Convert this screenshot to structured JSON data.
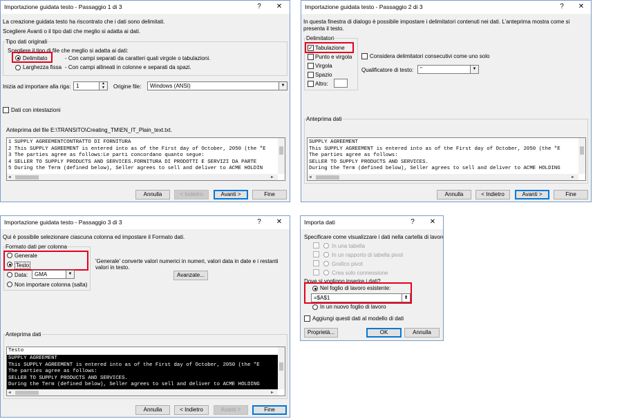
{
  "d1": {
    "title": "Importazione guidata testo - Passaggio 1 di 3",
    "help": "?",
    "close": "✕",
    "intro1": "La creazione guidata testo ha riscontrato che i dati sono delimitati.",
    "intro2": "Scegliere Avanti o il tipo dati che meglio si adatta ai dati.",
    "group_title": "Tipo dati originali",
    "choose_label": "Scegliere il tipo di file che meglio si adatta ai dati:",
    "opt_delim": "Delimitato",
    "opt_delim_desc": "- Con campi separati da caratteri quali virgole o tabulazioni.",
    "opt_fixed": "Larghezza fissa",
    "opt_fixed_desc": "- Con campi allineati in colonne e separati da spazi.",
    "start_row_label": "Inizia ad importare alla riga:",
    "start_row_value": "1",
    "origin_label": "Origine file:",
    "origin_value": "Windows (ANSI)",
    "headers_label": "Dati con intestazioni",
    "preview_label": "Anteprima del file E:\\TRANSITO\\Creating_TM\\EN_IT_Plain_text.txt.",
    "preview_lines": [
      "1 SUPPLY AGREEMENTCONTRATTO DI FORNITURA",
      "2 This SUPPLY AGREEMENT is entered into as of the First day of October, 2050 (the \"E",
      "3 The parties agree as follows:Le parti concordano quanto segue:",
      "4 SELLER TO SUPPLY PRODUCTS AND SERVICES.FORNITURA DI PRODOTTI E SERVIZI DA PARTE",
      "5 During the Term (defined below), Seller agrees to sell and deliver to ACME HOLDIN"
    ],
    "btn_cancel": "Annulla",
    "btn_back": "< Indietro",
    "btn_next": "Avanti >",
    "btn_finish": "Fine"
  },
  "d2": {
    "title": "Importazione guidata testo - Passaggio 2 di 3",
    "help": "?",
    "close": "✕",
    "intro1": "In questa finestra di dialogo è possibile impostare i delimitatori contenuti nei dati. L'anteprima mostra come si",
    "intro2": "presenta il testo.",
    "delim_title": "Delimitatori",
    "chk_tab": "Tabulazione",
    "chk_semicolon": "Punto e virgola",
    "chk_comma": "Virgola",
    "chk_space": "Spazio",
    "chk_other": "Altro:",
    "chk_tab_mark": "✓",
    "consecutive_label": "Considera delimitatori consecutivi come uno solo",
    "qualifier_label": "Qualificatore di testo:",
    "qualifier_value": "\"",
    "preview_label": "Anteprima dati",
    "preview_lines": [
      "SUPPLY AGREEMENT",
      "This SUPPLY AGREEMENT is entered into as of the First day of October, 2050 (the \"E",
      "The parties agree as follows:",
      "SELLER TO SUPPLY PRODUCTS AND SERVICES.",
      "During the Term (defined below), Seller agrees to sell and deliver to ACME HOLDING"
    ],
    "btn_cancel": "Annulla",
    "btn_back": "< Indietro",
    "btn_next": "Avanti >",
    "btn_finish": "Fine"
  },
  "d3": {
    "title": "Importazione guidata testo - Passaggio 3 di 3",
    "help": "?",
    "close": "✕",
    "intro1": "Qui è possibile selezionare ciascuna colonna ed impostare il Formato dati.",
    "group_title": "Formato dati per colonna",
    "opt_general": "Generale",
    "opt_text": "Testo",
    "opt_date": "Data:",
    "date_value": "GMA",
    "opt_skip": "Non importare colonna (salta)",
    "general_note1": "'Generale' converte valori numerici in numeri, valori data in date e i restanti",
    "general_note2": "valori in testo.",
    "btn_advanced": "Avanzate...",
    "preview_label": "Anteprima dati",
    "col_header": "Testo",
    "preview_lines": [
      "SUPPLY AGREEMENT",
      "This SUPPLY AGREEMENT is entered into as of the First day of October, 2050 (the \"E",
      "The parties agree as follows:",
      "SELLER TO SUPPLY PRODUCTS AND SERVICES.",
      "During the Term (defined below), Seller agrees to sell and deliver to ACME HOLDING"
    ],
    "btn_cancel": "Annulla",
    "btn_back": "< Indietro",
    "btn_next": "Avanti >",
    "btn_finish": "Fine"
  },
  "d4": {
    "title": "Importa dati",
    "help": "?",
    "close": "✕",
    "view_label": "Specificare come visualizzare i dati nella cartella di lavoro.",
    "opt_table": "In una tabella",
    "opt_pivot_table": "In un rapporto di tabella pivot",
    "opt_pivot_chart": "Grafico pivot",
    "opt_connection": "Crea solo connessione",
    "where_label": "Dove si vogliono inserire i dati?",
    "opt_existing": "Nel foglio di lavoro esistente:",
    "cell_value": "=$A$1",
    "opt_new_sheet": "In un nuovo foglio di lavoro",
    "model_label": "Aggiungi questi dati al modello di dati",
    "btn_properties": "Proprietà...",
    "btn_ok": "OK",
    "btn_cancel": "Annulla"
  }
}
